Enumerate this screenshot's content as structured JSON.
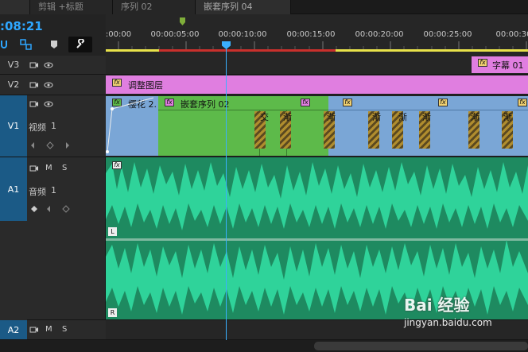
{
  "tabs": [
    "剪辑 +标题",
    "序列 02",
    "嵌套序列 04"
  ],
  "timecode": ":08:21",
  "ruler": {
    "labels": [
      ":00:00",
      "00:00:05:00",
      "00:00:10:00",
      "00:00:15:00",
      "00:00:20:00",
      "00:00:25:00",
      "00:00:30"
    ]
  },
  "tracks": {
    "v3": {
      "id": "V3"
    },
    "v2": {
      "id": "V2"
    },
    "v1": {
      "id": "V1",
      "name": "视频",
      "num": "1"
    },
    "a1": {
      "id": "A1",
      "name": "音频",
      "num": "1"
    },
    "a2": {
      "id": "A2"
    },
    "ms_m": "M",
    "ms_s": "S"
  },
  "clips": {
    "subtitle": "字幕 01",
    "adjustment": "调整图层",
    "sakura": "樱花 2.",
    "nested": "嵌套序列 02",
    "trans_labels": [
      "交",
      "渐",
      "渐",
      "渐",
      "渐",
      "渐",
      "渐",
      "渐",
      "渐"
    ],
    "fx": "fx",
    "audio_l": "L",
    "audio_r": "R"
  },
  "watermark": {
    "brand": "Bai 经验",
    "url": "jingyan.baidu.com"
  },
  "colors": {
    "accent": "#2ea6ff",
    "adjustment": "#e07ee0",
    "video_green": "#5dba4a",
    "video_blue": "#7aa6d6",
    "audio": "#2fd39a"
  }
}
